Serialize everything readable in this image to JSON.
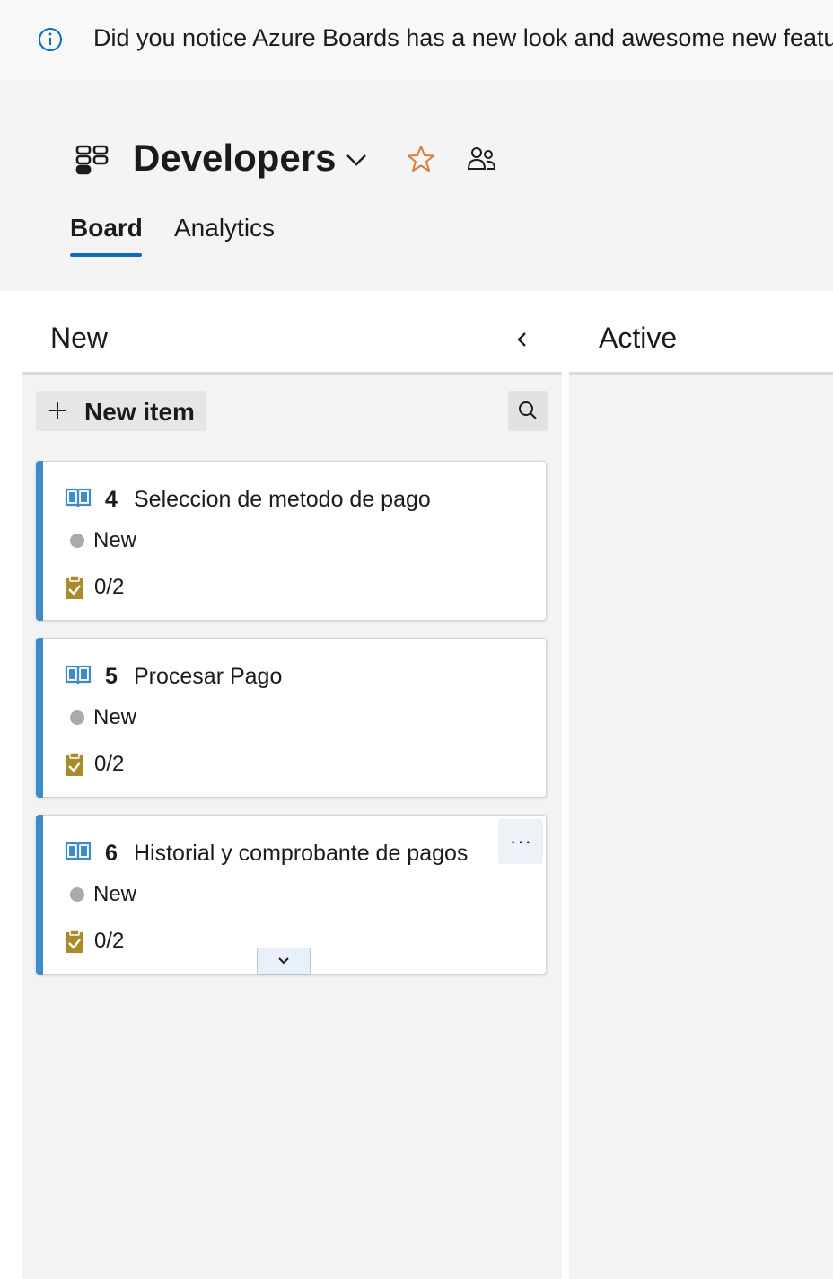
{
  "banner": {
    "message": "Did you notice Azure Boards has a new look and awesome new features?",
    "icon": "info-icon"
  },
  "header": {
    "team_name": "Developers",
    "team_icon": "team-board-icon",
    "tabs": [
      {
        "label": "Board",
        "active": true
      },
      {
        "label": "Analytics",
        "active": false
      }
    ]
  },
  "board": {
    "columns": [
      {
        "title": "New"
      },
      {
        "title": "Active"
      }
    ],
    "new_item_label": "New item",
    "cards": [
      {
        "id": "4",
        "title": "Seleccion de metodo de pago",
        "state": "New",
        "tasks": "0/2"
      },
      {
        "id": "5",
        "title": "Procesar Pago",
        "state": "New",
        "tasks": "0/2"
      },
      {
        "id": "6",
        "title": "Historial y comprobante de pagos",
        "state": "New",
        "tasks": "0/2"
      }
    ]
  },
  "colors": {
    "accent_blue": "#0f6cbd",
    "card_accent": "#3d8bc9",
    "star_orange": "#d67f3c",
    "task_gold": "#a98b2a",
    "state_gray": "#aaaaaa"
  }
}
